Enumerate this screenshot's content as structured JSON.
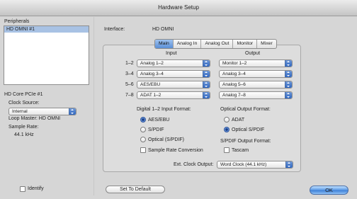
{
  "window": {
    "title": "Hardware Setup"
  },
  "sidebar": {
    "peripherals_label": "Peripherals",
    "peripherals": [
      "HD OMNI #1"
    ],
    "core_label": "HD Core PCIe #1",
    "clock_source_label": "Clock Source:",
    "clock_source_value": "Internal",
    "loop_master": "Loop Master: HD OMNI",
    "sample_rate_label": "Sample Rate:",
    "sample_rate_value": "44.1 kHz",
    "identify_label": "Identify"
  },
  "interface": {
    "label": "Interface:",
    "value": "HD OMNI"
  },
  "tabs": [
    "Main",
    "Analog In",
    "Analog Out",
    "Monitor",
    "Mixer"
  ],
  "active_tab": "Main",
  "routing": {
    "input_header": "Input",
    "output_header": "Output",
    "rows": [
      {
        "channels": "1–2",
        "input": "Analog 1–2",
        "output": "Monitor 1–2"
      },
      {
        "channels": "3–4",
        "input": "Analog 3–4",
        "output": "Analog 3–4"
      },
      {
        "channels": "5–6",
        "input": "AES/EBU",
        "output": "Analog 5–6"
      },
      {
        "channels": "7–8",
        "input": "ADAT 1–2",
        "output": "Analog 7–8"
      }
    ]
  },
  "digital_input": {
    "label": "Digital 1–2 Input Format:",
    "options": [
      {
        "label": "AES/EBU",
        "selected": true
      },
      {
        "label": "S/PDIF",
        "selected": false
      },
      {
        "label": "Optical (S/PDIF)",
        "selected": false
      }
    ],
    "src_label": "Sample Rate Conversion",
    "src_checked": false
  },
  "optical_output": {
    "label": "Optical Output Format:",
    "options": [
      {
        "label": "ADAT",
        "selected": false
      },
      {
        "label": "Optical S/PDIF",
        "selected": true
      }
    ]
  },
  "spdif_output": {
    "label": "S/PDIF Output Format:",
    "tascam_label": "Tascam",
    "tascam_checked": false
  },
  "ext_clock": {
    "label": "Ext. Clock Output:",
    "value": "Word Clock (44.1 kHz)"
  },
  "buttons": {
    "set_default": "Set To Default",
    "ok": "OK"
  },
  "colors": {
    "selection": "#a8c2e4",
    "accent": "#3b7ed6"
  }
}
